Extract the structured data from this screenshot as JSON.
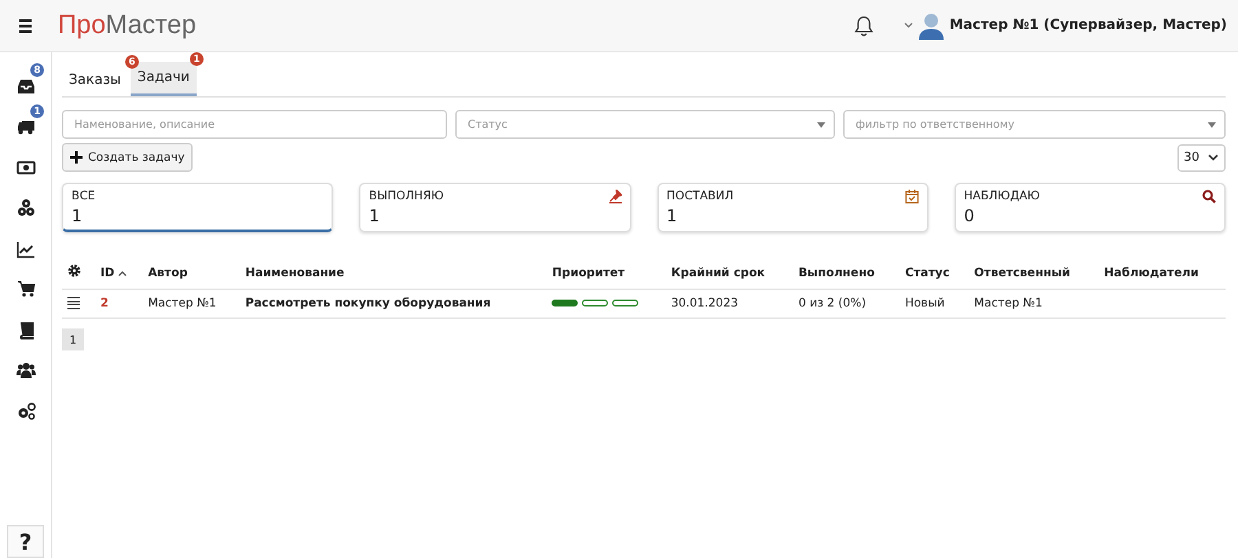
{
  "header": {
    "logo": {
      "accent": "Про",
      "rest": "Мастер"
    },
    "user": "Мастер №1 (Супервайзер, Мастер)"
  },
  "sidebar": {
    "items": [
      {
        "kind": "inbox",
        "badge": "8"
      },
      {
        "kind": "truck",
        "badge": "1"
      },
      {
        "kind": "money"
      },
      {
        "kind": "parts"
      },
      {
        "kind": "chart"
      },
      {
        "kind": "cart"
      },
      {
        "kind": "book"
      },
      {
        "kind": "users"
      },
      {
        "kind": "gears"
      }
    ],
    "help": "?"
  },
  "tabs": [
    {
      "label": "Заказы",
      "badge": "6",
      "selected": false
    },
    {
      "label": "Задачи",
      "badge": "1",
      "selected": true
    }
  ],
  "filters": {
    "search": {
      "placeholder": "Наменование, описание"
    },
    "status": {
      "placeholder": "Статус"
    },
    "assignee": {
      "placeholder": "фильтр по ответственному"
    }
  },
  "create_button": "Создать задачу",
  "page_size": "30",
  "cards": [
    {
      "kind": "all",
      "label": "ВСЕ",
      "count": "1",
      "selected": true
    },
    {
      "kind": "doing",
      "label": "ВЫПОЛНЯЮ",
      "count": "1",
      "selected": false
    },
    {
      "kind": "assigned",
      "label": "ПОСТАВИЛ",
      "count": "1",
      "selected": false
    },
    {
      "kind": "watching",
      "label": "НАБЛЮДАЮ",
      "count": "0",
      "selected": false
    }
  ],
  "table": {
    "columns": [
      "ID",
      "Автор",
      "Наименование",
      "Приоритет",
      "Крайний срок",
      "Выполнено",
      "Статус",
      "Ответсвенный",
      "Наблюдатели"
    ],
    "rows": [
      {
        "id": "2",
        "author": "Мастер №1",
        "name": "Рассмотреть покупку оборудования",
        "priority": {
          "stars": 1
        },
        "deadline": "30.01.2023",
        "done": "0 из 2 (0%)",
        "status": "Новый",
        "assignee": "Мастер №1"
      }
    ]
  },
  "pagination": [
    {
      "label": "1",
      "selected": true
    }
  ]
}
